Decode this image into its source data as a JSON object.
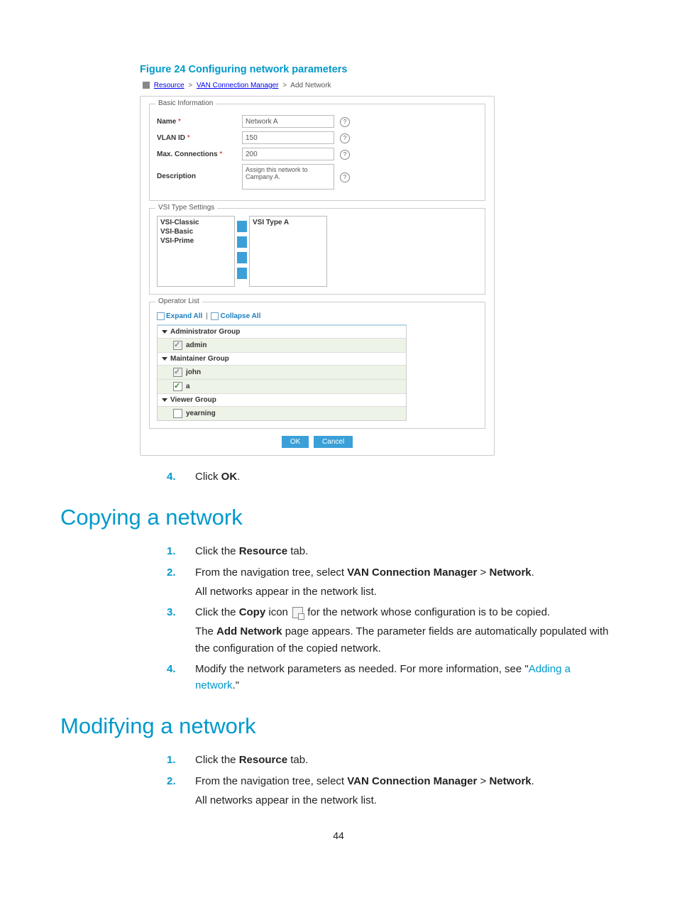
{
  "figure": {
    "caption": "Figure 24 Configuring network parameters",
    "breadcrumb": {
      "l1": "Resource",
      "l2": "VAN Connection Manager",
      "l3": "Add Network"
    },
    "basic": {
      "legend": "Basic Information",
      "name_label": "Name",
      "name_value": "Network A",
      "vlan_label": "VLAN ID",
      "vlan_value": "150",
      "max_label": "Max. Connections",
      "max_value": "200",
      "desc_label": "Description",
      "desc_value": "Assign this network to Campany A."
    },
    "vsi": {
      "legend": "VSI Type Settings",
      "available": [
        "VSI-Classic",
        "VSI-Basic",
        "VSI-Prime"
      ],
      "selected": [
        "VSI Type A"
      ]
    },
    "oplist": {
      "legend": "Operator List",
      "expand": "Expand All",
      "collapse": "Collapse All",
      "groups": [
        {
          "name": "Administrator Group",
          "users": [
            {
              "name": "admin",
              "checked": true,
              "locked": true
            }
          ]
        },
        {
          "name": "Maintainer Group",
          "users": [
            {
              "name": "john",
              "checked": true,
              "locked": true
            },
            {
              "name": "a",
              "checked": true,
              "locked": false
            }
          ]
        },
        {
          "name": "Viewer Group",
          "users": [
            {
              "name": "yearning",
              "checked": false,
              "locked": false
            }
          ]
        }
      ]
    },
    "buttons": {
      "ok": "OK",
      "cancel": "Cancel"
    }
  },
  "step_before": {
    "num": "4.",
    "text_a": "Click ",
    "text_bold": "OK",
    "text_b": "."
  },
  "section_copy": {
    "heading": "Copying a network",
    "steps": [
      {
        "num": "1.",
        "parts": [
          {
            "t": "Click the "
          },
          {
            "b": "Resource"
          },
          {
            "t": " tab."
          }
        ]
      },
      {
        "num": "2.",
        "parts": [
          {
            "t": "From the navigation tree, select "
          },
          {
            "b": "VAN Connection Manager"
          },
          {
            "t": " > "
          },
          {
            "b": "Network"
          },
          {
            "t": "."
          }
        ],
        "sub": "All networks appear in the network list."
      },
      {
        "num": "3.",
        "parts": [
          {
            "t": "Click the "
          },
          {
            "b": "Copy"
          },
          {
            "t": " icon  "
          },
          {
            "icon": "copy"
          },
          {
            "t": "  for the network whose configuration is to be copied."
          }
        ],
        "sub2_parts": [
          {
            "t": "The "
          },
          {
            "b": "Add Network"
          },
          {
            "t": " page appears. The parameter fields are automatically populated with the configuration of the copied network."
          }
        ]
      },
      {
        "num": "4.",
        "parts": [
          {
            "t": "Modify the network parameters as needed. For more information, see \""
          },
          {
            "a": "Adding a network"
          },
          {
            "t": ".\""
          }
        ]
      }
    ]
  },
  "section_modify": {
    "heading": "Modifying a network",
    "steps": [
      {
        "num": "1.",
        "parts": [
          {
            "t": "Click the "
          },
          {
            "b": "Resource"
          },
          {
            "t": " tab."
          }
        ]
      },
      {
        "num": "2.",
        "parts": [
          {
            "t": "From the navigation tree, select "
          },
          {
            "b": "VAN Connection Manager"
          },
          {
            "t": " > "
          },
          {
            "b": "Network"
          },
          {
            "t": "."
          }
        ],
        "sub": "All networks appear in the network list."
      }
    ]
  },
  "pagenum": "44"
}
